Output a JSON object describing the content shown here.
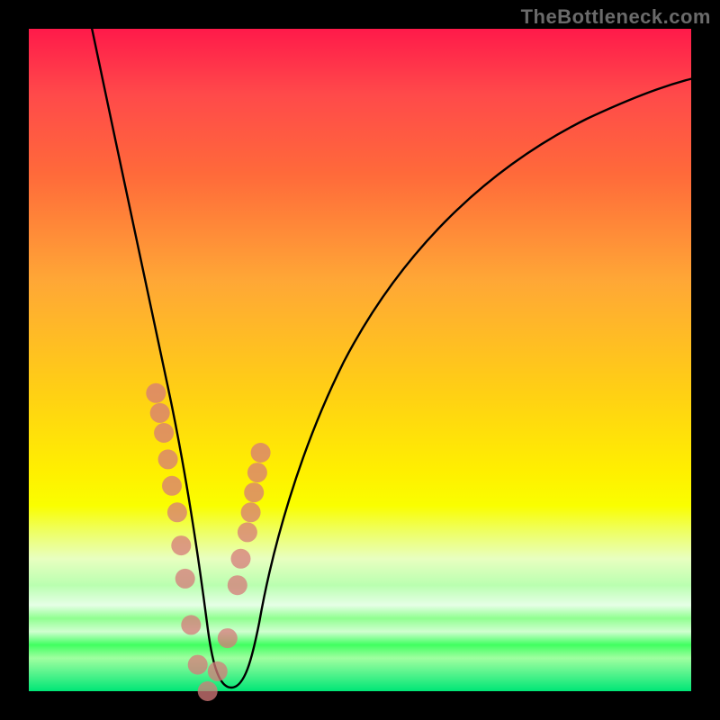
{
  "watermark": "TheBottleneck.com",
  "chart_data": {
    "type": "line",
    "title": "",
    "xlabel": "",
    "ylabel": "",
    "xlim": [
      0,
      100
    ],
    "ylim": [
      0,
      100
    ],
    "grid": false,
    "legend": false,
    "series": [
      {
        "name": "bottleneck-curve",
        "note": "V-shaped curve; minimum near x≈27 at y≈0; left branch steep from top-left, right branch rises toward upper right",
        "x": [
          9,
          12,
          15,
          18,
          20,
          22,
          24,
          25,
          27,
          29,
          31,
          33,
          35,
          38,
          42,
          48,
          55,
          65,
          78,
          92,
          100
        ],
        "y": [
          100,
          86,
          70,
          54,
          42,
          32,
          18,
          8,
          0,
          4,
          12,
          22,
          30,
          40,
          50,
          60,
          68,
          76,
          82,
          86,
          88
        ]
      }
    ],
    "points": {
      "name": "sample-dots",
      "note": "salmon translucent markers clustered along lower portions of both branches",
      "x": [
        19.2,
        19.8,
        20.4,
        21.0,
        21.6,
        22.4,
        23.0,
        23.6,
        24.5,
        25.5,
        27.0,
        28.5,
        30.0,
        31.5,
        32.0,
        33.0,
        33.5,
        34.0,
        34.5,
        35.0
      ],
      "y": [
        45,
        42,
        39,
        35,
        31,
        27,
        22,
        17,
        10,
        4,
        0,
        3,
        8,
        16,
        20,
        24,
        27,
        30,
        33,
        36
      ]
    }
  }
}
